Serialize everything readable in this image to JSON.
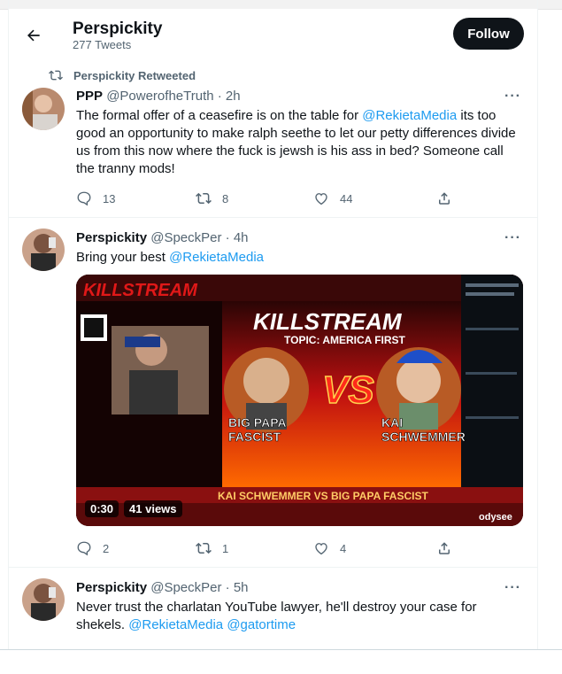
{
  "header": {
    "title": "Perspickity",
    "tweet_count": "277 Tweets",
    "follow_label": "Follow"
  },
  "tweets": [
    {
      "retweeted_by": "Perspickity Retweeted",
      "name": "PPP",
      "handle": "@PowerofheTruth",
      "time": "· 2h",
      "text_parts": [
        "The formal offer of a ceasefire is on the table for ",
        "@RekietaMedia",
        " its too good an opportunity to make ralph seethe to let our petty differences divide us from this now where the fuck is jewsh is his ass in bed? Someone call the tranny mods!"
      ],
      "replies": "13",
      "retweets": "8",
      "likes": "44"
    },
    {
      "name": "Perspickity",
      "handle": "@SpeckPer",
      "time": "· 4h",
      "text_parts": [
        "Bring your best ",
        "@RekietaMedia"
      ],
      "media": {
        "brand_text": "KILLSTREAM",
        "topic": "TOPIC: AMERICA FIRST",
        "vs": "VS",
        "left_caption": "BIG PAPA FASCIST",
        "right_caption": "KAI SCHWEMMER",
        "banner": "KAI SCHWEMMER VS BIG PAPA FASCIST",
        "duration": "0:30",
        "views": "41 views",
        "watermark": "odysee"
      },
      "replies": "2",
      "retweets": "1",
      "likes": "4"
    },
    {
      "name": "Perspickity",
      "handle": "@SpeckPer",
      "time": "· 5h",
      "text_parts": [
        "Never trust the charlatan YouTube lawyer, he'll destroy your case for shekels. ",
        "@RekietaMedia",
        " ",
        "@gatortime"
      ]
    }
  ],
  "colors": {
    "accent": "#1d9bf0",
    "text": "#0f1419",
    "muted": "#536471",
    "follow_bg": "#0f1419"
  }
}
